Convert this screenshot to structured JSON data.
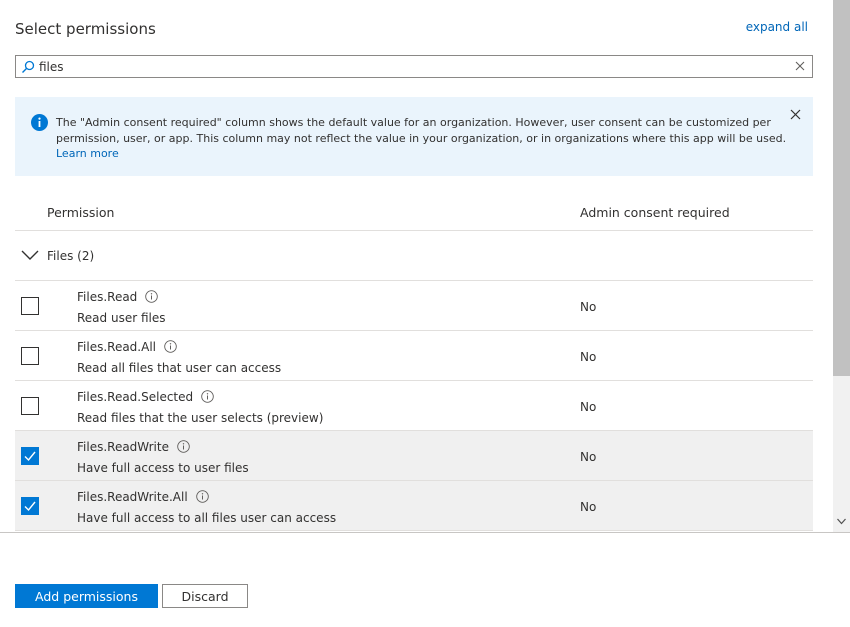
{
  "header": {
    "title": "Select permissions",
    "expand_all": "expand all"
  },
  "search": {
    "value": "files",
    "icon": "search-icon"
  },
  "info_banner": {
    "text": "The \"Admin consent required\" column shows the default value for an organization. However, user consent can be customized per permission, user, or app. This column may not reflect the value in your organization, or in organizations where this app will be used.",
    "link": "Learn more",
    "accent": "#0078d4",
    "background": "#eaf4fc"
  },
  "table": {
    "col_permission": "Permission",
    "col_admin_consent": "Admin consent required",
    "group": {
      "label": "Files (2)",
      "expanded": true
    },
    "rows": [
      {
        "name": "Files.Read",
        "description": "Read user files",
        "admin_consent": "No",
        "checked": false
      },
      {
        "name": "Files.Read.All",
        "description": "Read all files that user can access",
        "admin_consent": "No",
        "checked": false
      },
      {
        "name": "Files.Read.Selected",
        "description": "Read files that the user selects (preview)",
        "admin_consent": "No",
        "checked": false
      },
      {
        "name": "Files.ReadWrite",
        "description": "Have full access to user files",
        "admin_consent": "No",
        "checked": true
      },
      {
        "name": "Files.ReadWrite.All",
        "description": "Have full access to all files user can access",
        "admin_consent": "No",
        "checked": true
      }
    ]
  },
  "footer": {
    "add_permissions": "Add permissions",
    "discard": "Discard",
    "primary_color": "#0078d4"
  }
}
